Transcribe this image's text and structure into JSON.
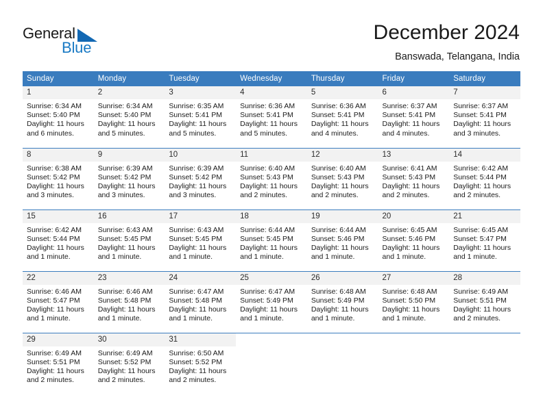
{
  "brand": {
    "name_part1": "General",
    "name_part2": "Blue",
    "accent_color": "#1268b3"
  },
  "header": {
    "title": "December 2024",
    "location": "Banswada, Telangana, India"
  },
  "theme": {
    "header_row_color": "#3a7cbe",
    "daynum_bg": "#f2f2f2"
  },
  "weekdays": [
    "Sunday",
    "Monday",
    "Tuesday",
    "Wednesday",
    "Thursday",
    "Friday",
    "Saturday"
  ],
  "weeks": [
    [
      {
        "day": "1",
        "sunrise": "Sunrise: 6:34 AM",
        "sunset": "Sunset: 5:40 PM",
        "daylight": "Daylight: 11 hours and 6 minutes."
      },
      {
        "day": "2",
        "sunrise": "Sunrise: 6:34 AM",
        "sunset": "Sunset: 5:40 PM",
        "daylight": "Daylight: 11 hours and 5 minutes."
      },
      {
        "day": "3",
        "sunrise": "Sunrise: 6:35 AM",
        "sunset": "Sunset: 5:41 PM",
        "daylight": "Daylight: 11 hours and 5 minutes."
      },
      {
        "day": "4",
        "sunrise": "Sunrise: 6:36 AM",
        "sunset": "Sunset: 5:41 PM",
        "daylight": "Daylight: 11 hours and 5 minutes."
      },
      {
        "day": "5",
        "sunrise": "Sunrise: 6:36 AM",
        "sunset": "Sunset: 5:41 PM",
        "daylight": "Daylight: 11 hours and 4 minutes."
      },
      {
        "day": "6",
        "sunrise": "Sunrise: 6:37 AM",
        "sunset": "Sunset: 5:41 PM",
        "daylight": "Daylight: 11 hours and 4 minutes."
      },
      {
        "day": "7",
        "sunrise": "Sunrise: 6:37 AM",
        "sunset": "Sunset: 5:41 PM",
        "daylight": "Daylight: 11 hours and 3 minutes."
      }
    ],
    [
      {
        "day": "8",
        "sunrise": "Sunrise: 6:38 AM",
        "sunset": "Sunset: 5:42 PM",
        "daylight": "Daylight: 11 hours and 3 minutes."
      },
      {
        "day": "9",
        "sunrise": "Sunrise: 6:39 AM",
        "sunset": "Sunset: 5:42 PM",
        "daylight": "Daylight: 11 hours and 3 minutes."
      },
      {
        "day": "10",
        "sunrise": "Sunrise: 6:39 AM",
        "sunset": "Sunset: 5:42 PM",
        "daylight": "Daylight: 11 hours and 3 minutes."
      },
      {
        "day": "11",
        "sunrise": "Sunrise: 6:40 AM",
        "sunset": "Sunset: 5:43 PM",
        "daylight": "Daylight: 11 hours and 2 minutes."
      },
      {
        "day": "12",
        "sunrise": "Sunrise: 6:40 AM",
        "sunset": "Sunset: 5:43 PM",
        "daylight": "Daylight: 11 hours and 2 minutes."
      },
      {
        "day": "13",
        "sunrise": "Sunrise: 6:41 AM",
        "sunset": "Sunset: 5:43 PM",
        "daylight": "Daylight: 11 hours and 2 minutes."
      },
      {
        "day": "14",
        "sunrise": "Sunrise: 6:42 AM",
        "sunset": "Sunset: 5:44 PM",
        "daylight": "Daylight: 11 hours and 2 minutes."
      }
    ],
    [
      {
        "day": "15",
        "sunrise": "Sunrise: 6:42 AM",
        "sunset": "Sunset: 5:44 PM",
        "daylight": "Daylight: 11 hours and 1 minute."
      },
      {
        "day": "16",
        "sunrise": "Sunrise: 6:43 AM",
        "sunset": "Sunset: 5:45 PM",
        "daylight": "Daylight: 11 hours and 1 minute."
      },
      {
        "day": "17",
        "sunrise": "Sunrise: 6:43 AM",
        "sunset": "Sunset: 5:45 PM",
        "daylight": "Daylight: 11 hours and 1 minute."
      },
      {
        "day": "18",
        "sunrise": "Sunrise: 6:44 AM",
        "sunset": "Sunset: 5:45 PM",
        "daylight": "Daylight: 11 hours and 1 minute."
      },
      {
        "day": "19",
        "sunrise": "Sunrise: 6:44 AM",
        "sunset": "Sunset: 5:46 PM",
        "daylight": "Daylight: 11 hours and 1 minute."
      },
      {
        "day": "20",
        "sunrise": "Sunrise: 6:45 AM",
        "sunset": "Sunset: 5:46 PM",
        "daylight": "Daylight: 11 hours and 1 minute."
      },
      {
        "day": "21",
        "sunrise": "Sunrise: 6:45 AM",
        "sunset": "Sunset: 5:47 PM",
        "daylight": "Daylight: 11 hours and 1 minute."
      }
    ],
    [
      {
        "day": "22",
        "sunrise": "Sunrise: 6:46 AM",
        "sunset": "Sunset: 5:47 PM",
        "daylight": "Daylight: 11 hours and 1 minute."
      },
      {
        "day": "23",
        "sunrise": "Sunrise: 6:46 AM",
        "sunset": "Sunset: 5:48 PM",
        "daylight": "Daylight: 11 hours and 1 minute."
      },
      {
        "day": "24",
        "sunrise": "Sunrise: 6:47 AM",
        "sunset": "Sunset: 5:48 PM",
        "daylight": "Daylight: 11 hours and 1 minute."
      },
      {
        "day": "25",
        "sunrise": "Sunrise: 6:47 AM",
        "sunset": "Sunset: 5:49 PM",
        "daylight": "Daylight: 11 hours and 1 minute."
      },
      {
        "day": "26",
        "sunrise": "Sunrise: 6:48 AM",
        "sunset": "Sunset: 5:49 PM",
        "daylight": "Daylight: 11 hours and 1 minute."
      },
      {
        "day": "27",
        "sunrise": "Sunrise: 6:48 AM",
        "sunset": "Sunset: 5:50 PM",
        "daylight": "Daylight: 11 hours and 1 minute."
      },
      {
        "day": "28",
        "sunrise": "Sunrise: 6:49 AM",
        "sunset": "Sunset: 5:51 PM",
        "daylight": "Daylight: 11 hours and 2 minutes."
      }
    ],
    [
      {
        "day": "29",
        "sunrise": "Sunrise: 6:49 AM",
        "sunset": "Sunset: 5:51 PM",
        "daylight": "Daylight: 11 hours and 2 minutes."
      },
      {
        "day": "30",
        "sunrise": "Sunrise: 6:49 AM",
        "sunset": "Sunset: 5:52 PM",
        "daylight": "Daylight: 11 hours and 2 minutes."
      },
      {
        "day": "31",
        "sunrise": "Sunrise: 6:50 AM",
        "sunset": "Sunset: 5:52 PM",
        "daylight": "Daylight: 11 hours and 2 minutes."
      },
      {
        "day": "",
        "sunrise": "",
        "sunset": "",
        "daylight": ""
      },
      {
        "day": "",
        "sunrise": "",
        "sunset": "",
        "daylight": ""
      },
      {
        "day": "",
        "sunrise": "",
        "sunset": "",
        "daylight": ""
      },
      {
        "day": "",
        "sunrise": "",
        "sunset": "",
        "daylight": ""
      }
    ]
  ]
}
